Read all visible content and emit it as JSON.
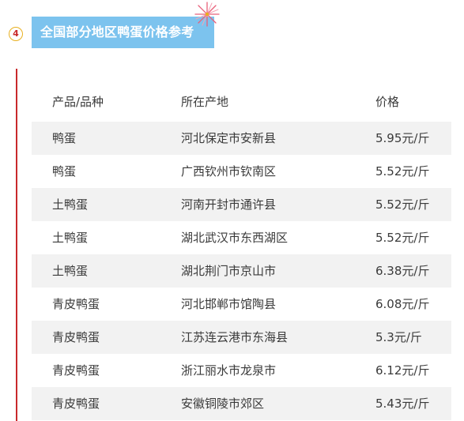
{
  "section": {
    "number": "4",
    "title": "全国部分地区鸭蛋价格参考",
    "decoration_icon": "firework-icon"
  },
  "colors": {
    "title_bg": "#7cc3ee",
    "accent_red": "#c8292b",
    "badge_border": "#e8b020",
    "row_shade": "#f2f2f2"
  },
  "table": {
    "headers": [
      "产品/品种",
      "所在产地",
      "价格"
    ],
    "rows": [
      [
        "鸭蛋",
        "河北保定市安新县",
        "5.95元/斤"
      ],
      [
        "鸭蛋",
        "广西钦州市钦南区",
        "5.52元/斤"
      ],
      [
        "土鸭蛋",
        "河南开封市通许县",
        "5.52元/斤"
      ],
      [
        "土鸭蛋",
        "湖北武汉市东西湖区",
        "5.52元/斤"
      ],
      [
        "土鸭蛋",
        "湖北荆门市京山市",
        "6.38元/斤"
      ],
      [
        "青皮鸭蛋",
        "河北邯郸市馆陶县",
        "6.08元/斤"
      ],
      [
        "青皮鸭蛋",
        "江苏连云港市东海县",
        "5.3元/斤"
      ],
      [
        "青皮鸭蛋",
        "浙江丽水市龙泉市",
        "6.12元/斤"
      ],
      [
        "青皮鸭蛋",
        "安徽铜陵市郊区",
        "5.43元/斤"
      ]
    ]
  }
}
